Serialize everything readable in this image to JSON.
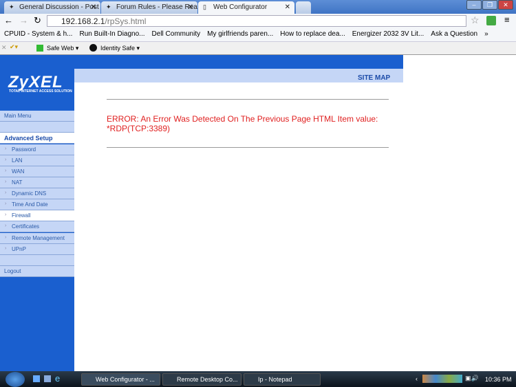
{
  "browser": {
    "tabs": [
      {
        "label": "General Discussion - Post"
      },
      {
        "label": "Forum Rules - Please Reac"
      },
      {
        "label": "Web Configurator",
        "active": true
      }
    ],
    "url_host": "192.168.2.1",
    "url_path": "/rpSys.html",
    "bookmarks": [
      "CPUID - System & h...",
      "Run Built-In Diagno...",
      "Dell Community",
      "My girlfriends paren...",
      "How to replace dea...",
      "Energizer 2032 3V Lit...",
      "Ask a Question"
    ],
    "toolbar": {
      "safe_web": "Safe Web ▾",
      "identity_safe": "Identity Safe ▾"
    }
  },
  "router": {
    "logo": "ZyXEL",
    "tagline": "TOTAL INTERNET ACCESS SOLUTION",
    "site_map": "SITE MAP",
    "menu": {
      "main": "Main Menu",
      "section": "Advanced Setup",
      "items": [
        "Password",
        "LAN",
        "WAN",
        "NAT",
        "Dynamic DNS",
        "Time And Date",
        "Firewall",
        "Certificates",
        "Remote Management",
        "UPnP"
      ],
      "selected": "Firewall",
      "logout": "Logout"
    },
    "error": "ERROR: An Error Was Detected On The Previous Page     HTML Item value: *RDP(TCP:3389)"
  },
  "taskbar": {
    "items": [
      "Web Configurator - ...",
      "Remote Desktop Co...",
      "Ip - Notepad"
    ],
    "clock": "10:36 PM"
  },
  "colors": {
    "brand_blue": "#1a5fcf",
    "error_red": "#e02020"
  }
}
